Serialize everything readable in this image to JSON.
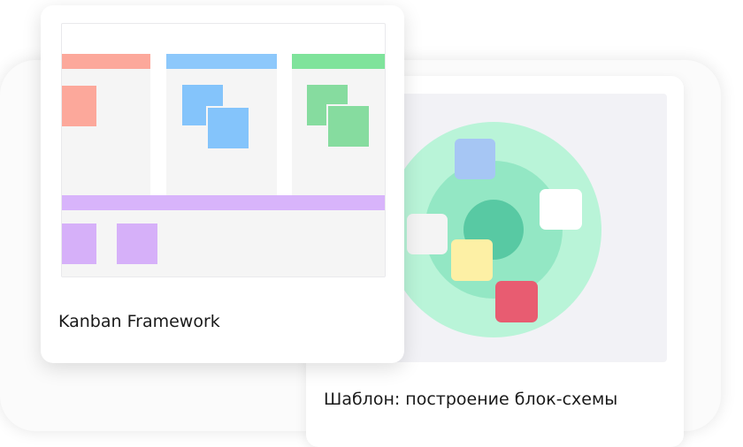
{
  "cards": [
    {
      "title": "Kanban Framework",
      "thumbnail": {
        "columns": [
          {
            "header_color": "#fca89b",
            "note_color": "#fca89b"
          },
          {
            "header_color": "#8dc8fb",
            "note_color": "#84c4fb"
          },
          {
            "header_color": "#7fe39b",
            "note_color": "#86dc9f"
          }
        ],
        "swimlane_color": "#d8b4fb",
        "swimlane_note_color": "#d6b0f9"
      }
    },
    {
      "title": "Шаблон: построение блок-схемы",
      "thumbnail": {
        "rings": [
          "#b9f4d8",
          "#93e7c4",
          "#58c9a3"
        ],
        "node_colors": [
          "#a6c6f4",
          "#ffffff",
          "#f4f4f4",
          "#fdf0a5",
          "#e85c71"
        ]
      }
    }
  ]
}
